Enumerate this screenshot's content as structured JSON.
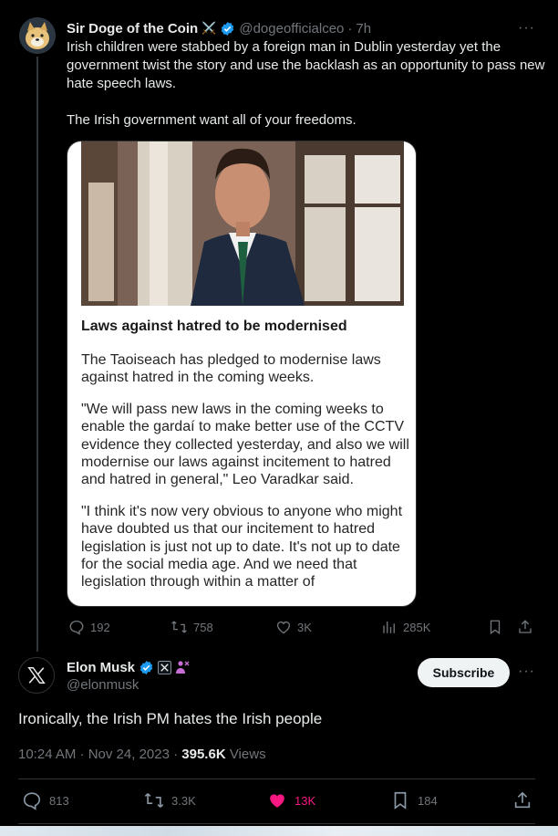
{
  "reply": {
    "author_name": "Sir Doge of the Coin",
    "author_emoji": "⚔️",
    "author_handle": "@dogeofficialceo",
    "separator": "·",
    "time": "7h",
    "text_p1": "Irish children were stabbed by a foreign man in Dublin yesterday yet the government twist the story and use the backlash as an opportunity to pass new hate speech laws.",
    "text_p2": "The Irish government want all of your freedoms.",
    "image": {
      "headline": "Laws against hatred to be modernised",
      "p1": "The Taoiseach has pledged to modernise laws against hatred in the coming weeks.",
      "p2": "\"We will pass new laws in the coming weeks to enable the gardaí to make better use of the CCTV evidence they collected yesterday, and also we will modernise our laws against incitement to hatred and hatred in general,\" Leo Varadkar said.",
      "p3": "\"I think it's now very obvious to anyone who might have doubted us that our incitement to hatred legislation is just not up to date. It's not up to date for the social media age. And we need that legislation through within a matter of"
    },
    "stats": {
      "replies": "192",
      "reposts": "758",
      "likes": "3K",
      "views": "285K"
    }
  },
  "main": {
    "author_name": "Elon Musk",
    "author_handle": "@elonmusk",
    "subscribe_label": "Subscribe",
    "text": "Ironically, the Irish PM hates the Irish people",
    "time": "10:24 AM · Nov 24, 2023 · ",
    "views_count": "395.6K",
    "views_label": " Views",
    "stats": {
      "replies": "813",
      "reposts": "3.3K",
      "likes": "13K",
      "bookmarks": "184"
    }
  },
  "colors": {
    "verified": "#1d9bf0",
    "like": "#f91880",
    "muted": "#71767b",
    "background": "#000000"
  },
  "icons": [
    "reply-icon",
    "repost-icon",
    "like-icon",
    "views-icon",
    "bookmark-icon",
    "share-icon",
    "verified-icon",
    "x-logo-icon",
    "more-icon"
  ]
}
